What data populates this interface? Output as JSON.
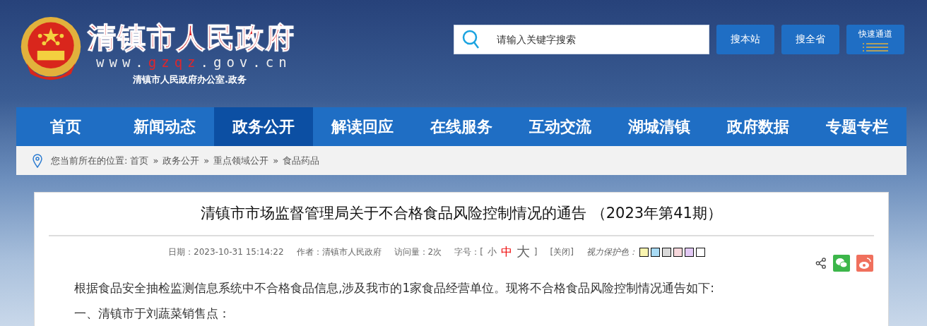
{
  "header": {
    "site_name": "清镇市人民政府",
    "url_prefix": "www.",
    "url_domain": "gzqz",
    "url_suffix": ".gov.cn",
    "subtitle": "清镇市人民政府办公室.政务"
  },
  "search": {
    "placeholder": "请输入关键字搜索",
    "buttons": [
      "搜本站",
      "搜全省"
    ],
    "quick_access": "快速通道"
  },
  "nav": [
    {
      "label": "首页",
      "selected": false
    },
    {
      "label": "新闻动态",
      "selected": false
    },
    {
      "label": "政务公开",
      "selected": true
    },
    {
      "label": "解读回应",
      "selected": false
    },
    {
      "label": "在线服务",
      "selected": false
    },
    {
      "label": "互动交流",
      "selected": false
    },
    {
      "label": "湖城清镇",
      "selected": false
    },
    {
      "label": "政府数据",
      "selected": false
    },
    {
      "label": "专题专栏",
      "selected": false
    }
  ],
  "breadcrumb": {
    "label": "您当前所在的位置:",
    "separator": "»",
    "items": [
      "首页",
      "政务公开",
      "重点领域公开",
      "食品药品"
    ]
  },
  "article": {
    "title": "清镇市市场监督管理局关于不合格食品风险控制情况的通告 （2023年第41期）",
    "date": "日期：2023-10-31 15:14:22",
    "author": "作者：清镇市人民政府",
    "visits": "访问量：2次",
    "font_size_label": "字号：[",
    "font_sizes": [
      {
        "label": "小",
        "selected": false
      },
      {
        "label": "中",
        "selected": true
      },
      {
        "label": "大",
        "selected": false
      }
    ],
    "font_size_end": "]",
    "close": "[关闭]",
    "eye_care_label": "视力保护色：",
    "eye_care_colors": [
      {
        "color": "#faf5b0"
      },
      {
        "color": "#a8dbf5"
      },
      {
        "color": "#d9d9d9"
      },
      {
        "color": "#f7d7dc"
      },
      {
        "color": "#e3c9f5"
      },
      {
        "color": "#ffffff"
      }
    ],
    "paragraphs": [
      "根据食品安全抽检监测信息系统中不合格食品信息,涉及我市的1家食品经营单位。现将不合格食品风险控制情况通告如下:",
      "一、清镇市于刘蔬菜销售点："
    ]
  }
}
